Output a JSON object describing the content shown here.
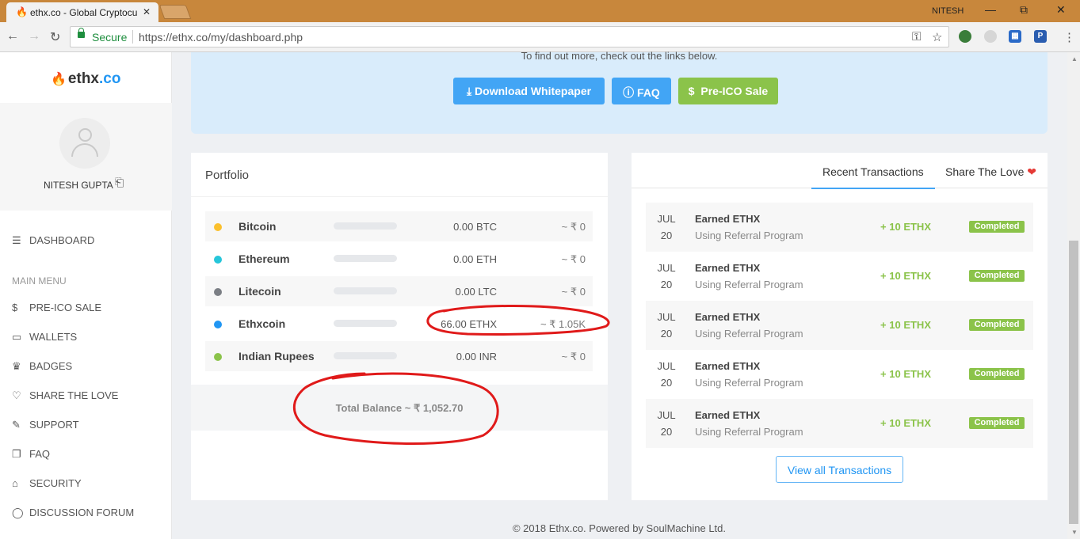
{
  "browser": {
    "tab_title": "ethx.co - Global Cryptocu",
    "tab_close": "✕",
    "profile": "NITESH",
    "secure_label": "Secure",
    "url": "https://ethx.co/my/dashboard.php"
  },
  "sidebar": {
    "logo_main": "ethx",
    "logo_tld": ".co",
    "user_name": "NITESH GUPTA",
    "dashboard": "DASHBOARD",
    "menu_heading": "MAIN MENU",
    "items": [
      {
        "label": "PRE-ICO SALE",
        "icon": "dollar-icon"
      },
      {
        "label": "WALLETS",
        "icon": "wallet-icon"
      },
      {
        "label": "BADGES",
        "icon": "trophy-icon"
      },
      {
        "label": "SHARE THE LOVE",
        "icon": "heart-icon"
      },
      {
        "label": "SUPPORT",
        "icon": "edit-icon"
      },
      {
        "label": "FAQ",
        "icon": "document-icon"
      },
      {
        "label": "SECURITY",
        "icon": "lock-icon"
      },
      {
        "label": "DISCUSSION FORUM",
        "icon": "chat-icon"
      }
    ]
  },
  "banner": {
    "text": "To find out more, check out the links below.",
    "download_whitepaper": "Download Whitepaper",
    "faq": "FAQ",
    "pre_ico": "Pre-ICO Sale",
    "colors": {
      "primary": "#2196f3",
      "success": "#8bc34a"
    }
  },
  "portfolio": {
    "title": "Portfolio",
    "coins": [
      {
        "name": "Bitcoin",
        "amount": "0.00 BTC",
        "value": "~ ₹ 0",
        "color": "#fbc02d",
        "share": 0
      },
      {
        "name": "Ethereum",
        "amount": "0.00 ETH",
        "value": "~ ₹ 0",
        "color": "#26c6da",
        "share": 0
      },
      {
        "name": "Litecoin",
        "amount": "0.00 LTC",
        "value": "~ ₹ 0",
        "color": "#7b7f85",
        "share": 0
      },
      {
        "name": "Ethxcoin",
        "amount": "66.00 ETHX",
        "value": "~ ₹ 1.05K",
        "color": "#2196f3",
        "share": 1
      },
      {
        "name": "Indian Rupees",
        "amount": "0.00 INR",
        "value": "~ ₹ 0",
        "color": "#8bc34a",
        "share": 0
      }
    ],
    "total": "Total Balance ~ ₹ 1,052.70"
  },
  "transactions": {
    "tab_recent": "Recent Transactions",
    "tab_share": "Share The Love",
    "items": [
      {
        "month": "JUL",
        "day": "20",
        "title": "Earned ETHX",
        "subtitle": "Using Referral Program",
        "amount": "+ 10 ETHX",
        "status": "Completed"
      },
      {
        "month": "JUL",
        "day": "20",
        "title": "Earned ETHX",
        "subtitle": "Using Referral Program",
        "amount": "+ 10 ETHX",
        "status": "Completed"
      },
      {
        "month": "JUL",
        "day": "20",
        "title": "Earned ETHX",
        "subtitle": "Using Referral Program",
        "amount": "+ 10 ETHX",
        "status": "Completed"
      },
      {
        "month": "JUL",
        "day": "20",
        "title": "Earned ETHX",
        "subtitle": "Using Referral Program",
        "amount": "+ 10 ETHX",
        "status": "Completed"
      },
      {
        "month": "JUL",
        "day": "20",
        "title": "Earned ETHX",
        "subtitle": "Using Referral Program",
        "amount": "+ 10 ETHX",
        "status": "Completed"
      }
    ],
    "view_all": "View all Transactions"
  },
  "footer": "© 2018 Ethx.co. Powered by SoulMachine Ltd."
}
